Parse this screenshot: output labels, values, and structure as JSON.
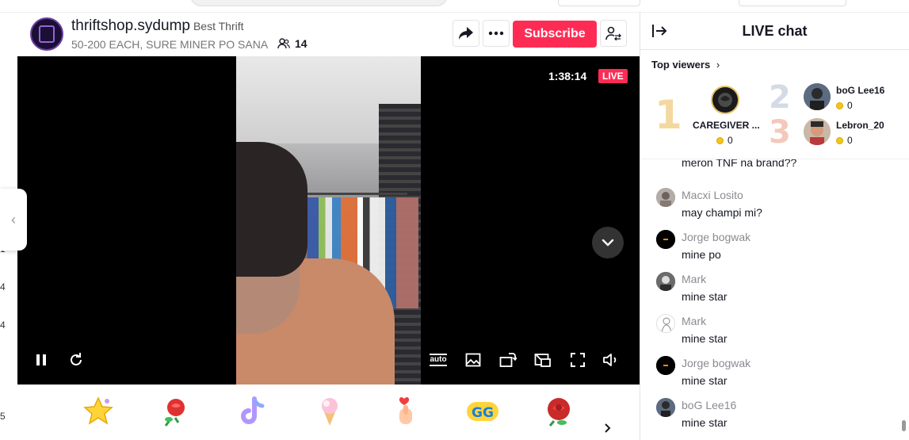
{
  "header": {
    "username": "thriftshop.sydump",
    "nickname": "Best Thrift",
    "description": "50-200 EACH, SURE MINER PO SANA",
    "viewer_count": "14",
    "subscribe_label": "Subscribe"
  },
  "video": {
    "elapsed": "1:38:14",
    "live_label": "LIVE",
    "quality_label": "auto"
  },
  "left_rail": {
    "numbers": [
      "1",
      "4",
      "4",
      "5"
    ]
  },
  "gifts": [
    {
      "name": "star-gift-icon"
    },
    {
      "name": "rose-gift-icon"
    },
    {
      "name": "tiktok-gift-icon"
    },
    {
      "name": "ice-cream-gift-icon"
    },
    {
      "name": "finger-heart-gift-icon"
    },
    {
      "name": "gg-gift-icon"
    },
    {
      "name": "red-rose-gift-icon"
    }
  ],
  "chat": {
    "title": "LIVE chat",
    "top_viewers_label": "Top viewers",
    "top_viewers": [
      {
        "rank": "1",
        "name": "CAREGIVER ...",
        "coins": "0"
      },
      {
        "rank": "2",
        "name": "boG Lee16",
        "coins": "0"
      },
      {
        "rank": "3",
        "name": "Lebron_20",
        "coins": "0"
      }
    ],
    "messages": [
      {
        "user": "",
        "text": "meron TNF na brand??"
      },
      {
        "user": "Macxi Losito",
        "text": "may champi mi?"
      },
      {
        "user": "Jorge bogwak",
        "text": "mine po"
      },
      {
        "user": "Mark",
        "text": "mine star"
      },
      {
        "user": "Mark",
        "text": "mine star"
      },
      {
        "user": "Jorge bogwak",
        "text": "mine star"
      },
      {
        "user": "boG Lee16",
        "text": "mine star"
      }
    ]
  },
  "colors": {
    "accent": "#fe2c55",
    "gold": "#f5c518",
    "rank1": "#f3d9a0",
    "rank2": "#d4dbe6",
    "rank3": "#f3c9bb"
  }
}
